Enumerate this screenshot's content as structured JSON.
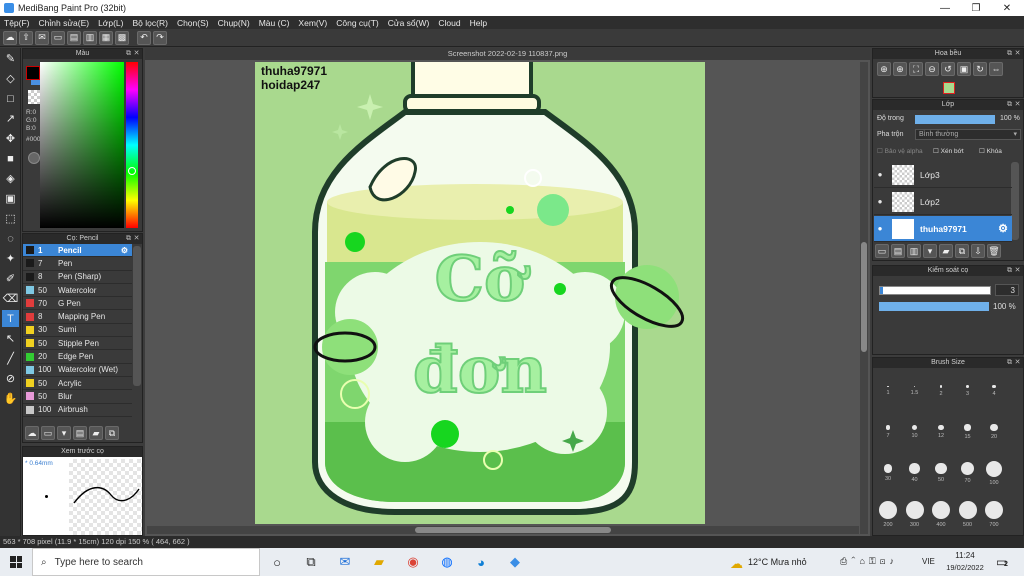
{
  "window": {
    "title": "MediBang Paint Pro (32bit)",
    "minimize": "—",
    "maximize": "❐",
    "close": "✕"
  },
  "menu": [
    "Tệp(F)",
    "Chỉnh sửa(E)",
    "Lớp(L)",
    "Bộ lọc(R)",
    "Chọn(S)",
    "Chụp(N)",
    "Màu (C)",
    "Xem(V)",
    "Công cụ(T)",
    "Cửa sổ(W)",
    "Cloud",
    "Help"
  ],
  "color_panel": {
    "title": "Màu",
    "r": "R:0",
    "g": "G:0",
    "b": "B:0",
    "hex": "#000000"
  },
  "brush_panel": {
    "title": "Cọ: Pencil",
    "brushes": [
      {
        "size": "1",
        "name": "Pencil",
        "color": "#1a1a1a",
        "selected": true
      },
      {
        "size": "7",
        "name": "Pen",
        "color": "#1a1a1a"
      },
      {
        "size": "8",
        "name": "Pen (Sharp)",
        "color": "#1a1a1a"
      },
      {
        "size": "50",
        "name": "Watercolor",
        "color": "#7ec8e3"
      },
      {
        "size": "70",
        "name": "G Pen",
        "color": "#e03c3c"
      },
      {
        "size": "8",
        "name": "Mapping Pen",
        "color": "#e03c3c"
      },
      {
        "size": "30",
        "name": "Sumi",
        "color": "#f0d020"
      },
      {
        "size": "50",
        "name": "Stipple Pen",
        "color": "#f0d020"
      },
      {
        "size": "20",
        "name": "Edge Pen",
        "color": "#33cc33"
      },
      {
        "size": "100",
        "name": "Watercolor (Wet)",
        "color": "#7ec8e3"
      },
      {
        "size": "50",
        "name": "Acrylic",
        "color": "#f0d020"
      },
      {
        "size": "50",
        "name": "Blur",
        "color": "#e89ad8"
      },
      {
        "size": "100",
        "name": "Airbrush",
        "color": "#c8c8c8"
      }
    ]
  },
  "preview_panel": {
    "title": "Xem trước cọ",
    "size": "0.64mm"
  },
  "document": {
    "tab": "Screenshot 2022-02-19 110837.png",
    "watermark_line1": "thuha97971",
    "watermark_line2": "hoidap247",
    "art_text_line1": "Cỡ",
    "art_text_line2": "đơn"
  },
  "navigator_panel": {
    "title": "Hoa bều"
  },
  "layer_panel": {
    "title": "Lớp",
    "opacity_label": "Độ trong",
    "opacity_value": "100 %",
    "blend_label": "Pha trộn",
    "blend_value": "Bình thường",
    "protect_alpha": "Bảo vệ alpha",
    "clipping": "Xén bớt",
    "lock": "Khóa",
    "layers": [
      {
        "name": "Lớp3",
        "selected": false
      },
      {
        "name": "Lớp2",
        "selected": false
      },
      {
        "name": "thuha97971",
        "selected": true
      }
    ]
  },
  "brush_control_panel": {
    "title": "Kiểm soát cọ",
    "size_value": "3",
    "opacity_value": "100 %"
  },
  "brush_size_panel": {
    "title": "Brush Size",
    "sizes": [
      "1",
      "1.5",
      "2",
      "3",
      "4",
      "7",
      "10",
      "12",
      "15",
      "20",
      "30",
      "40",
      "50",
      "70",
      "100",
      "200",
      "300",
      "400",
      "500",
      "700"
    ]
  },
  "status": {
    "text": "563 * 708 pixel   (11.9 * 15cm)   120 dpi   150 %   ( 464, 662 )"
  },
  "taskbar": {
    "search_placeholder": "Type here to search",
    "weather": "12°C  Mưa nhỏ",
    "language": "VIE",
    "time": "11:24",
    "date": "19/02/2022",
    "notifications": "2"
  }
}
